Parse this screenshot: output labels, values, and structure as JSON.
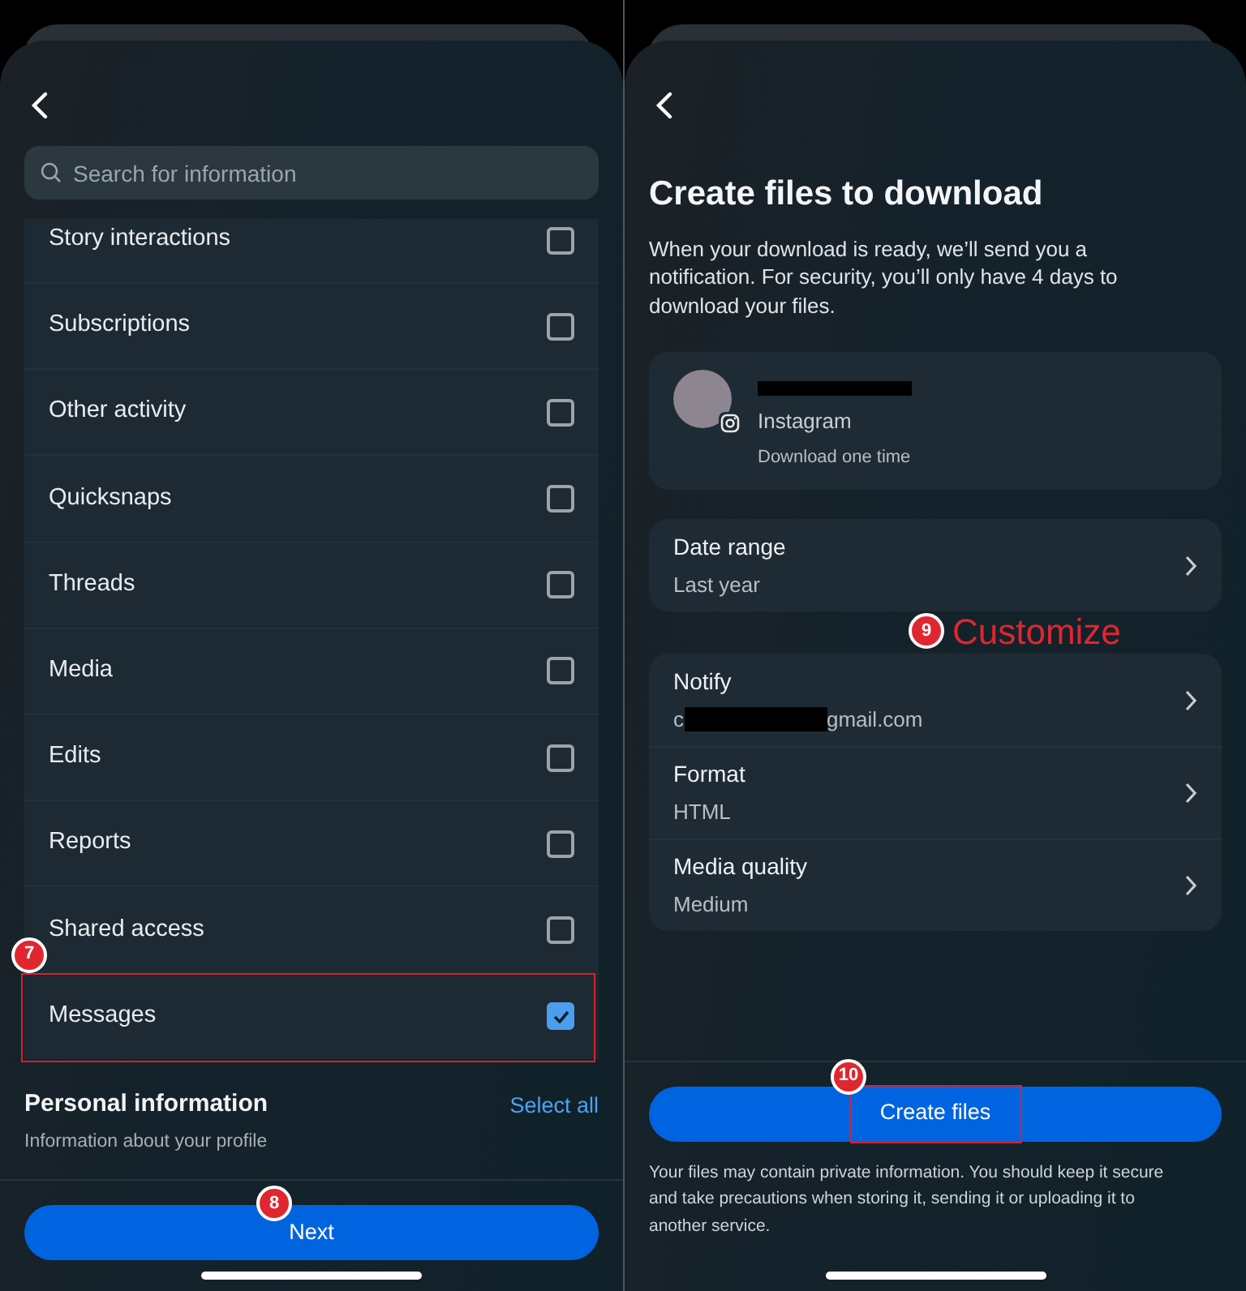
{
  "left_screen": {
    "search": {
      "placeholder": "Search for information"
    },
    "items": [
      {
        "label": "Story interactions",
        "checked": false,
        "framed": false
      },
      {
        "label": "Subscriptions",
        "checked": false,
        "framed": false
      },
      {
        "label": "Other activity",
        "checked": false,
        "framed": false
      },
      {
        "label": "Quicksnaps",
        "checked": false,
        "framed": false
      },
      {
        "label": "Threads",
        "checked": false,
        "framed": false
      },
      {
        "label": "Media",
        "checked": false,
        "framed": false
      },
      {
        "label": "Edits",
        "checked": false,
        "framed": false
      },
      {
        "label": "Reports",
        "checked": false,
        "framed": false
      },
      {
        "label": "Shared access",
        "checked": false,
        "framed": false
      },
      {
        "label": "Messages",
        "checked": true,
        "framed": true,
        "callout": "7"
      }
    ],
    "section": {
      "title": "Personal information",
      "subtitle": "Information about your profile",
      "action": "Select all"
    },
    "button": {
      "label": "Next",
      "callout": "8"
    }
  },
  "right_screen": {
    "title": "Create files to download",
    "description": "When your download is ready, we’ll send you a notification. For security, you’ll only have 4 days to download your files.",
    "account": {
      "app": "Instagram",
      "note": "Download one time"
    },
    "settings_groups": [
      [
        {
          "label": "Date range",
          "value": "Last year",
          "callout": {
            "number": "9",
            "label": "Customize"
          }
        }
      ],
      [
        {
          "label": "Notify",
          "value": "c",
          "value_tail": "gmail.com",
          "redacted": true
        },
        {
          "label": "Format",
          "value": "HTML",
          "redacted": false
        },
        {
          "label": "Media quality",
          "value": "Medium",
          "redacted": false
        }
      ]
    ],
    "button": {
      "label": "Create files",
      "callout": "10",
      "framed": true
    },
    "footer": "Your files may contain private information. You should keep it secure and take precautions when storing it, sending it or uploading it to another service."
  }
}
